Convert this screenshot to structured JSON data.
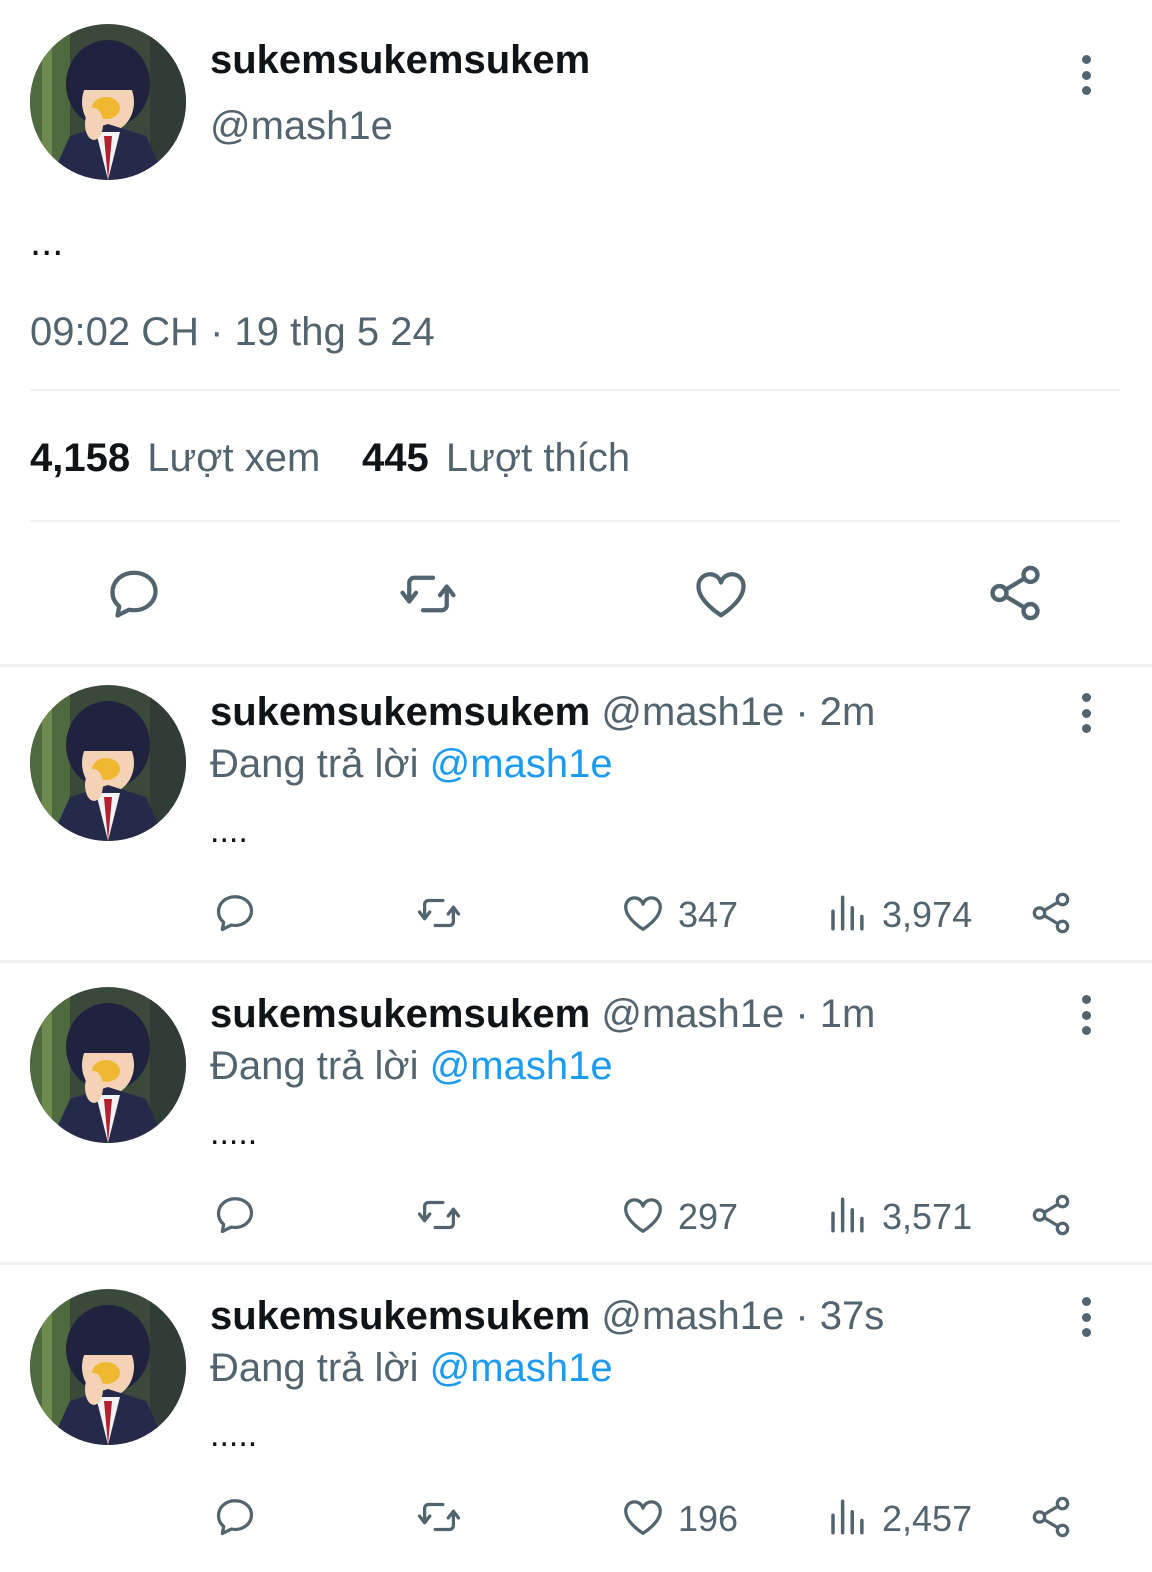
{
  "main_tweet": {
    "display_name": "sukemsukemsukem",
    "handle": "@mash1e",
    "text": "...",
    "timestamp": "09:02 CH · 19 thg 5 24",
    "views_count": "4,158",
    "views_label": "Lượt xem",
    "likes_count": "445",
    "likes_label": "Lượt thích"
  },
  "replies": [
    {
      "display_name": "sukemsukemsukem",
      "handle_time": "@mash1e · 2m",
      "replying_prefix": "Đang trả lời",
      "replying_to": "@mash1e",
      "text": "....",
      "likes": "347",
      "views": "3,974"
    },
    {
      "display_name": "sukemsukemsukem",
      "handle_time": "@mash1e · 1m",
      "replying_prefix": "Đang trả lời",
      "replying_to": "@mash1e",
      "text": ".....",
      "likes": "297",
      "views": "3,571"
    },
    {
      "display_name": "sukemsukemsukem",
      "handle_time": "@mash1e · 37s",
      "replying_prefix": "Đang trả lời",
      "replying_to": "@mash1e",
      "text": ".....",
      "likes": "196",
      "views": "2,457"
    }
  ],
  "icons": [
    "more-vertical-icon",
    "reply-icon",
    "retweet-icon",
    "like-icon",
    "share-icon",
    "views-icon"
  ],
  "colors": {
    "text": "#0f1419",
    "secondary": "#536471",
    "link": "#1d9bf0",
    "divider": "#eff3f4"
  }
}
